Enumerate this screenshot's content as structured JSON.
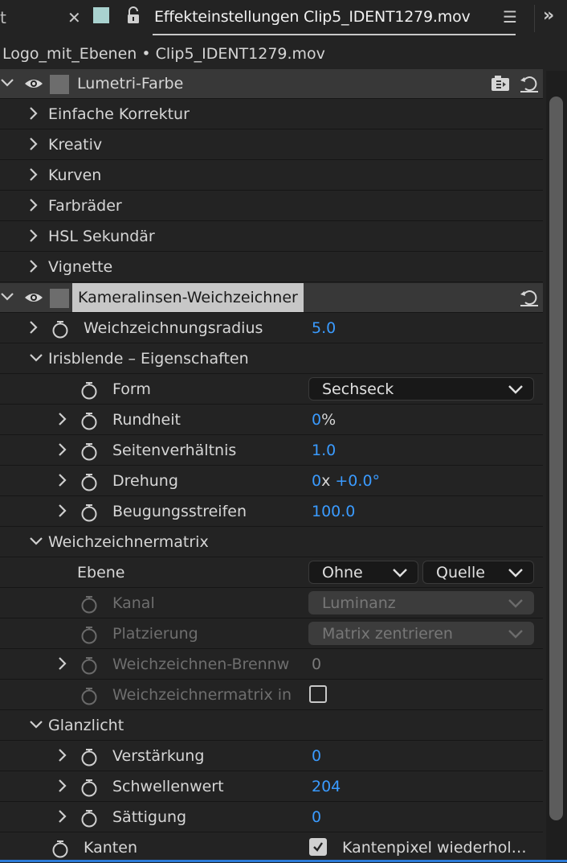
{
  "tabbar": {
    "cut_tab_text": "t",
    "close_glyph": "✕",
    "active_tab_title": "Effekteinstellungen Clip5_IDENT1279.mov",
    "menu_glyph": "☰",
    "overflow_glyph": "»"
  },
  "breadcrumb": "Logo_mit_Ebenen • Clip5_IDENT1279.mov",
  "effects": {
    "lumetri": {
      "name": "Lumetri-Farbe",
      "sections": [
        "Einfache Korrektur",
        "Kreativ",
        "Kurven",
        "Farbräder",
        "HSL Sekundär",
        "Vignette"
      ]
    },
    "blur": {
      "name": "Kameralinsen-Weichzeichner",
      "radius_label": "Weichzeichnungsradius",
      "radius_value": "5.0",
      "iris_group": "Irisblende – Eigenschaften",
      "form_label": "Form",
      "form_value": "Sechseck",
      "roundness_label": "Rundheit",
      "roundness_value": "0",
      "roundness_unit": "%",
      "aspect_label": "Seitenverhältnis",
      "aspect_value": "1.0",
      "rotation_label": "Drehung",
      "rotation_turns": "0",
      "rotation_x": "x",
      "rotation_deg": "+0.0°",
      "diffraction_label": "Beugungsstreifen",
      "diffraction_value": "100.0",
      "matrix_group": "Weichzeichnermatrix",
      "layer_label": "Ebene",
      "layer_value": "Ohne",
      "source_value": "Quelle",
      "channel_label": "Kanal",
      "channel_value": "Luminanz",
      "placement_label": "Platzierung",
      "placement_value": "Matrix zentrieren",
      "focal_label": "Weichzeichnen-Brennw",
      "focal_value": "0",
      "invert_label": "Weichzeichnermatrix in",
      "highlight_group": "Glanzlicht",
      "gain_label": "Verstärkung",
      "gain_value": "0",
      "threshold_label": "Schwellenwert",
      "threshold_value": "204",
      "saturation_label": "Sättigung",
      "saturation_value": "0",
      "edges_label": "Kanten",
      "edges_option": "Kantenpixel wiederhol…"
    }
  }
}
